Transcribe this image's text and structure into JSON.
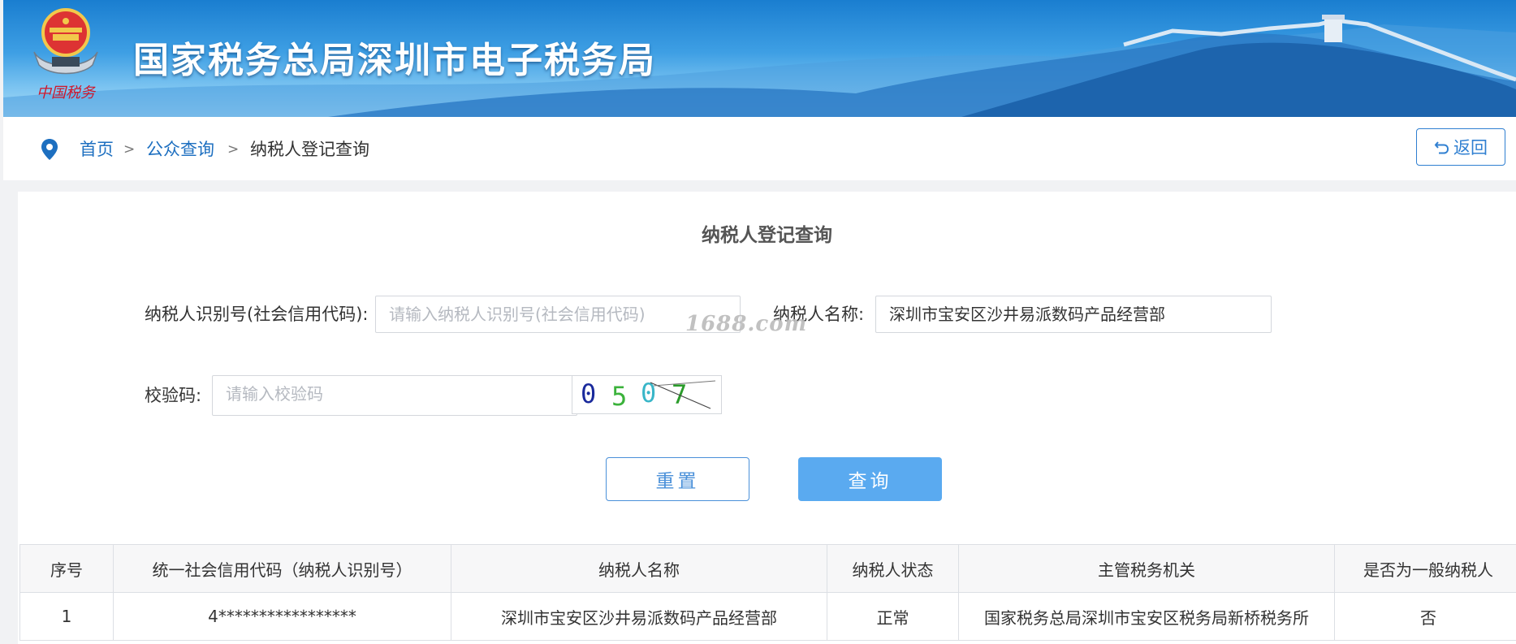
{
  "site": {
    "title": "国家税务总局深圳市电子税务局",
    "emblem_caption": "中国税务"
  },
  "breadcrumb": {
    "home": "首页",
    "sep": ">",
    "public": "公众查询",
    "current": "纳税人登记查询"
  },
  "back_button": {
    "label": "返回",
    "icon": "undo-arrow-icon"
  },
  "form": {
    "title": "纳税人登记查询",
    "taxpayer_id": {
      "label": "纳税人识别号(社会信用代码):",
      "placeholder": "请输入纳税人识别号(社会信用代码)",
      "value": ""
    },
    "taxpayer_name": {
      "label": "纳税人名称:",
      "value": "深圳市宝安区沙井易派数码产品经营部"
    },
    "captcha": {
      "label": "校验码:",
      "placeholder": "请输入校验码",
      "value": "",
      "image_text": "0507"
    },
    "reset_label": "重置",
    "query_label": "查询"
  },
  "watermark": "1688.com",
  "results": {
    "headers": [
      "序号",
      "统一社会信用代码（纳税人识别号）",
      "纳税人名称",
      "纳税人状态",
      "主管税务机关",
      "是否为一般纳税人"
    ],
    "rows": [
      [
        "1",
        "4*****************",
        "深圳市宝安区沙井易派数码产品经营部",
        "正常",
        "国家税务总局深圳市宝安区税务局新桥税务所",
        "否"
      ]
    ]
  },
  "colors": {
    "brand_blue": "#1d6fc0",
    "button_blue": "#5aaaf0",
    "banner_blue": "#2b8fdc"
  }
}
